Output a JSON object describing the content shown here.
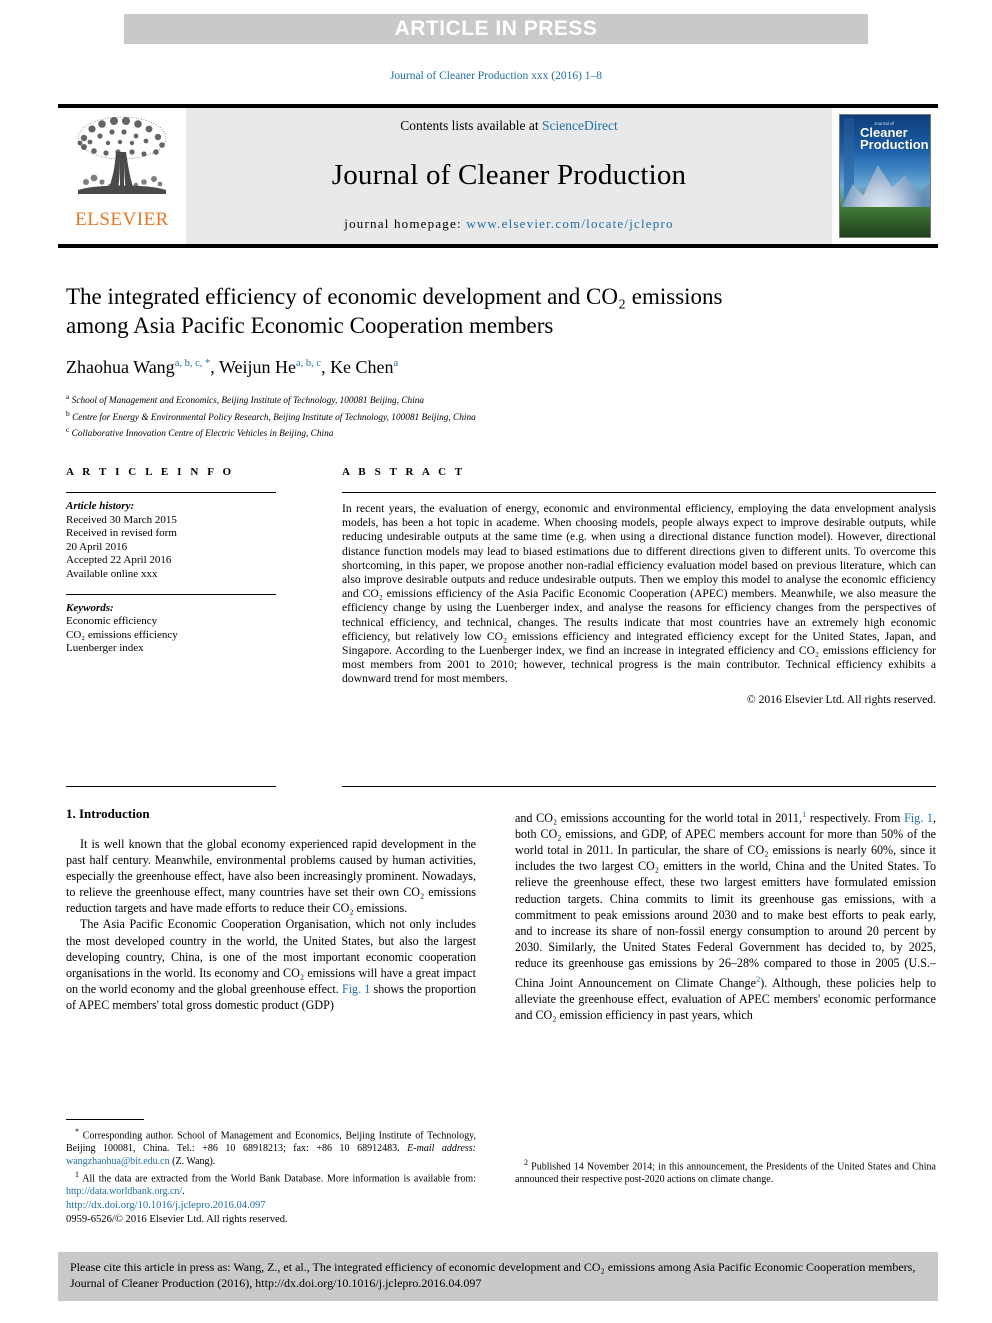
{
  "banner": {
    "text": "ARTICLE IN PRESS"
  },
  "running_head": "Journal of Cleaner Production xxx (2016) 1–8",
  "masthead": {
    "publisher_word": "ELSEVIER",
    "contents_prefix": "Contents lists available at ",
    "contents_link": "ScienceDirect",
    "journal_title": "Journal of Cleaner Production",
    "homepage_prefix": "journal homepage: ",
    "homepage_url": "www.elsevier.com/locate/jclepro",
    "cover": {
      "line_small": "Journal of",
      "line_big_1": "Cleaner",
      "line_big_2": "Production"
    }
  },
  "article": {
    "title_line_1": "The integrated efficiency of economic development and CO₂ emissions",
    "title_line_2": "among Asia Pacific Economic Cooperation members",
    "authors": [
      {
        "name": "Zhaohua Wang",
        "marks": "a, b, c, *"
      },
      {
        "name": "Weijun He",
        "marks": "a, b, c"
      },
      {
        "name": "Ke Chen",
        "marks": "a"
      }
    ],
    "affiliations": [
      {
        "mark": "a",
        "text": "School of Management and Economics, Beijing Institute of Technology, 100081 Beijing, China"
      },
      {
        "mark": "b",
        "text": "Centre for Energy & Environmental Policy Research, Beijing Institute of Technology, 100081 Beijing, China"
      },
      {
        "mark": "c",
        "text": "Collaborative Innovation Centre of Electric Vehicles in Beijing, China"
      }
    ]
  },
  "info": {
    "heading": "A R T I C L E   I N F O",
    "history_label": "Article history:",
    "history": [
      "Received 30 March 2015",
      "Received in revised form",
      "20 April 2016",
      "Accepted 22 April 2016",
      "Available online xxx"
    ],
    "keywords_label": "Keywords:",
    "keywords": [
      "Economic efficiency",
      "CO₂ emissions efficiency",
      "Luenberger index"
    ]
  },
  "abstract": {
    "heading": "A B S T R A C T",
    "text": "In recent years, the evaluation of energy, economic and environmental efficiency, employing the data envelopment analysis models, has been a hot topic in academe. When choosing models, people always expect to improve desirable outputs, while reducing undesirable outputs at the same time (e.g. when using a directional distance function model). However, directional distance function models may lead to biased estimations due to different directions given to different units. To overcome this shortcoming, in this paper, we propose another non-radial efficiency evaluation model based on previous literature, which can also improve desirable outputs and reduce undesirable outputs. Then we employ this model to analyse the economic efficiency and CO₂ emissions efficiency of the Asia Pacific Economic Cooperation (APEC) members. Meanwhile, we also measure the efficiency change by using the Luenberger index, and analyse the reasons for efficiency changes from the perspectives of technical efficiency, and technical, changes. The results indicate that most countries have an extremely high economic efficiency, but relatively low CO₂ emissions efficiency and integrated efficiency except for the United States, Japan, and Singapore. According to the Luenberger index, we find an increase in integrated efficiency and CO₂ emissions efficiency for most members from 2001 to 2010; however, technical progress is the main contributor. Technical efficiency exhibits a downward trend for most members.",
    "copyright": "© 2016 Elsevier Ltd. All rights reserved."
  },
  "body": {
    "section_heading": "1. Introduction",
    "left_paragraph_1": "It is well known that the global economy experienced rapid development in the past half century. Meanwhile, environmental problems caused by human activities, especially the greenhouse effect, have also been increasingly prominent. Nowadays, to relieve the greenhouse effect, many countries have set their own CO₂ emissions reduction targets and have made efforts to reduce their CO₂ emissions.",
    "left_paragraph_2_a": "The Asia Pacific Economic Cooperation Organisation, which not only includes the most developed country in the world, the United States, but also the largest developing country, China, is one of the most important economic cooperation organisations in the world. Its economy and CO₂ emissions will have a great impact on the world economy and the global greenhouse effect. ",
    "left_paragraph_2_link": "Fig. 1",
    "left_paragraph_2_b": " shows the proportion of APEC members' total gross domestic product (GDP)",
    "right_paragraph_a": "and CO₂ emissions accounting for the world total in 2011,",
    "right_footnote_mark_1": "1",
    "right_paragraph_b": " respectively. From ",
    "right_link_1": "Fig. 1",
    "right_paragraph_c": ", both CO₂ emissions, and GDP, of APEC members account for more than 50% of the world total in 2011. In particular, the share of CO₂ emissions is nearly 60%, since it includes the two largest CO₂ emitters in the world, China and the United States. To relieve the greenhouse effect, these two largest emitters have formulated emission reduction targets. China commits to limit its greenhouse gas emissions, with a commitment to peak emissions around 2030 and to make best efforts to peak early, and to increase its share of non-fossil energy consumption to around 20 percent by 2030. Similarly, the United States Federal Government has decided to, by 2025, reduce its greenhouse gas emissions by 26–28% compared to those in 2005 (U.S.–China Joint Announcement on Climate Change",
    "right_footnote_mark_2": "2",
    "right_paragraph_d": "). Although, these policies help to alleviate the greenhouse effect, evaluation of APEC members' economic performance and CO₂ emission efficiency in past years, which"
  },
  "footnotes": {
    "corresponding_mark": "*",
    "corresponding_text": " Corresponding author. School of Management and Economics, Beijing Institute of Technology, Beijing 100081, China. Tel.: +86 10 68918213; fax: +86 10 68912483.",
    "email_label": "E-mail address:",
    "email": "wangzhaohua@bit.edu.cn",
    "email_suffix": " (Z. Wang).",
    "fn1_mark": "1",
    "fn1_text_a": " All the data are extracted from the World Bank Database. More information is available from: ",
    "fn1_link": "http://data.worldbank.org.cn/",
    "fn1_text_b": ".",
    "fn2_mark": "2",
    "fn2_text": " Published 14 November 2014; in this announcement, the Presidents of the United States and China announced their respective post-2020 actions on climate change."
  },
  "doi_block": {
    "doi_url": "http://dx.doi.org/10.1016/j.jclepro.2016.04.097",
    "issn_line": "0959-6526/© 2016 Elsevier Ltd. All rights reserved."
  },
  "cite_box": {
    "text": "Please cite this article in press as: Wang, Z., et al., The integrated efficiency of economic development and CO₂ emissions among Asia Pacific Economic Cooperation members, Journal of Cleaner Production (2016), http://dx.doi.org/10.1016/j.jclepro.2016.04.097"
  },
  "colors": {
    "link": "#1f6fa8",
    "elsevier_orange": "#e87722",
    "banner_gray": "#c9c9c9",
    "masthead_gray": "#e9e9e9"
  }
}
